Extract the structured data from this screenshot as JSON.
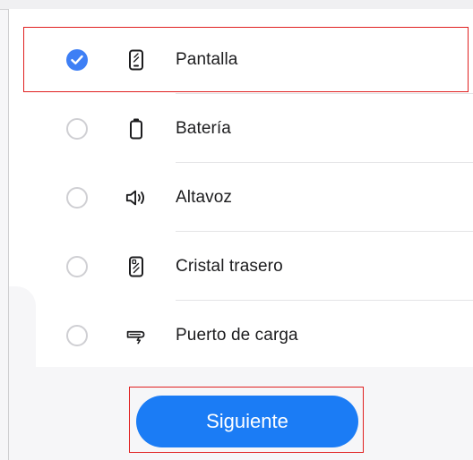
{
  "options": [
    {
      "label": "Pantalla",
      "icon": "phone-screen-icon",
      "checked": true
    },
    {
      "label": "Batería",
      "icon": "battery-icon",
      "checked": false
    },
    {
      "label": "Altavoz",
      "icon": "speaker-icon",
      "checked": false
    },
    {
      "label": "Cristal trasero",
      "icon": "back-glass-icon",
      "checked": false
    },
    {
      "label": "Puerto de carga",
      "icon": "charging-port-icon",
      "checked": false
    }
  ],
  "next_button": {
    "label": "Siguiente"
  },
  "colors": {
    "accent": "#3e7ff5",
    "button": "#1b7cf5",
    "highlight": "#e02020"
  }
}
